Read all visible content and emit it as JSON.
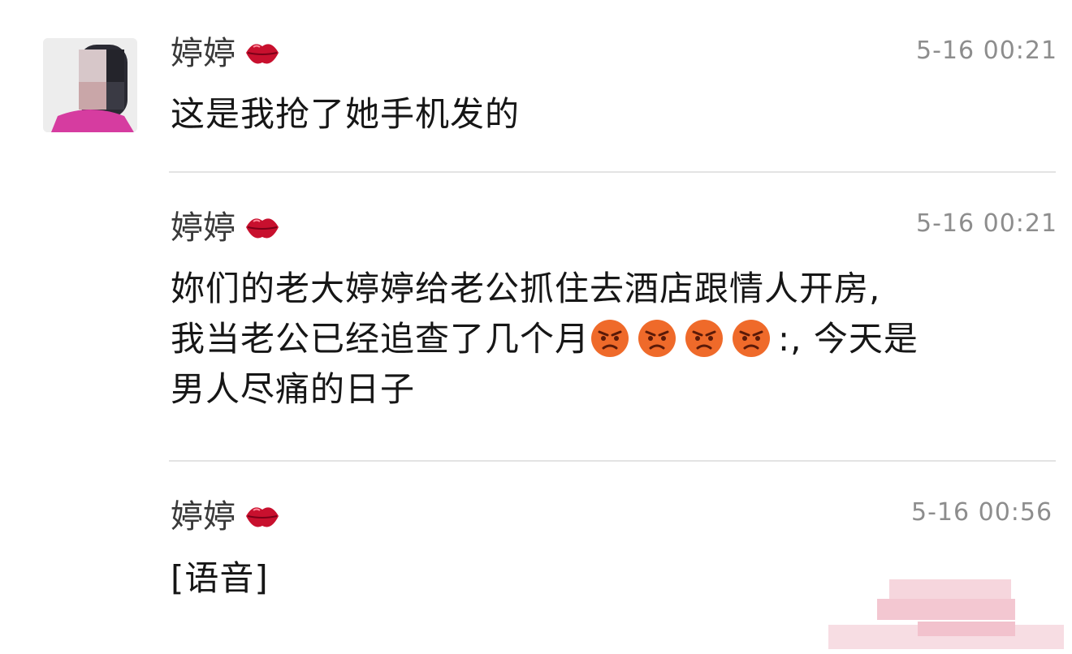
{
  "messages": [
    {
      "sender": "婷婷",
      "time": "5-16 00:21",
      "text": "这是我抢了她手机发的"
    },
    {
      "sender": "婷婷",
      "time": "5-16 00:21",
      "line1": "妳们的老大婷婷给老公抓住去酒店跟情人开房,",
      "line2_before": "我当老公已经追查了几个月",
      "line2_after": ":, 今天是",
      "line3": "男人尽痛的日子"
    },
    {
      "sender": "婷婷",
      "time": "5-16 00:56",
      "text": "[语音]"
    }
  ],
  "icons": {
    "sender_badge": "kissing-lips-icon",
    "emoji": "angry-face-icon",
    "avatar": "blurred-profile-photo"
  },
  "colors": {
    "lips": "#c8102e",
    "angry_face": "#ef6a2a",
    "avatar_shirt": "#d63ca0",
    "divider": "#e3e3e3",
    "timestamp": "#8d8d8d"
  }
}
